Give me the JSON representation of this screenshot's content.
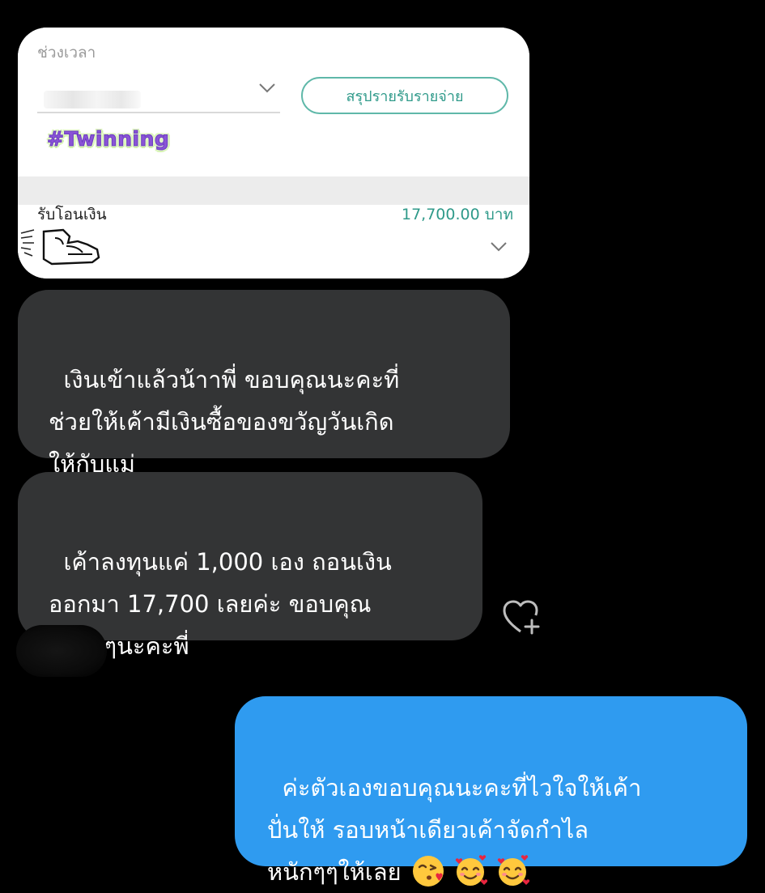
{
  "shared_card": {
    "period_label": "ช่วงเวลา",
    "summary_button": "สรุปรายรับรายจ่าย",
    "sticker_text": "#Twinning",
    "transfer_label": "รับโอนเงิน",
    "transfer_amount": "17,700.00 บาท"
  },
  "messages": [
    {
      "direction": "incoming",
      "text": "เงินเข้าแล้วน้าาพี่ ขอบคุณนะคะที่\nช่วยให้เค้ามีเงินซื้อของขวัญวันเกิด\nให้กับแม่"
    },
    {
      "direction": "incoming",
      "text": "เค้าลงทุนแค่ 1,000 เอง ถอนเงิน\nออกมา 17,700 เลยค่ะ ขอบคุณ\nมากๆๆนะคะพี่"
    },
    {
      "direction": "outgoing",
      "text": "ค่ะตัวเองขอบคุณนะคะที่ไวใจให้เค้า\nปั่นให้ รอบหน้าเดียวเค้าจัดกำไล\nหนักๆๆให้เลย",
      "emojis": [
        "face-blowing-a-kiss",
        "smiling-face-with-hearts",
        "smiling-face-with-hearts"
      ]
    }
  ],
  "icons": {
    "react": "heart-plus-icon"
  },
  "colors": {
    "background": "#000000",
    "incoming_bubble": "#333435",
    "outgoing_bubble": "#2f9bf0",
    "accent_teal": "#2f9a8a"
  }
}
